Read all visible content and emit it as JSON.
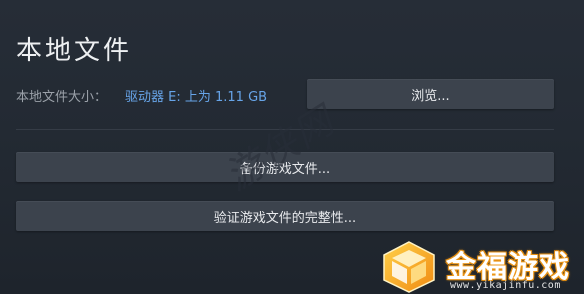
{
  "dialog": {
    "title": "本地文件",
    "local_size_label": "本地文件大小：",
    "local_size_value": "驱动器 E: 上为 1.11 GB"
  },
  "buttons": {
    "browse": "浏览...",
    "backup": "备份游戏文件...",
    "verify": "验证游戏文件的完整性..."
  },
  "watermark": {
    "text": "游侠网"
  },
  "logo": {
    "name": "金福游戏",
    "url": "www.yikajinfu.com",
    "icon": "gold-cube-icon"
  },
  "colors": {
    "background": "#1f252e",
    "button": "#3c434d",
    "link": "#67a4e8",
    "logo_accent": "#f5a623"
  }
}
